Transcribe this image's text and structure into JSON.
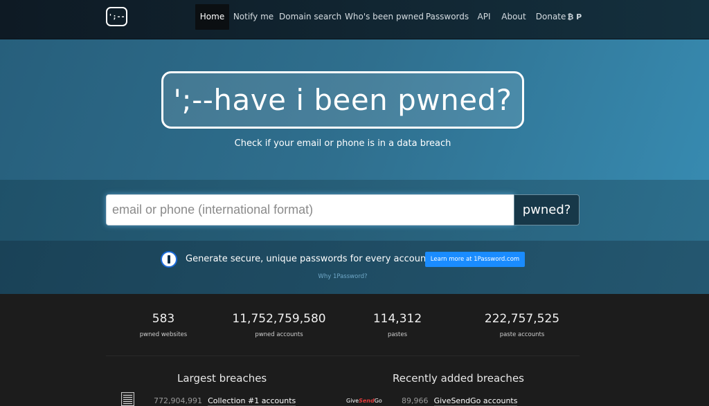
{
  "nav": {
    "logo_text": "';--",
    "items": [
      {
        "label": "Home",
        "active": true
      },
      {
        "label": "Notify me"
      },
      {
        "label": "Domain search"
      },
      {
        "label": "Who's been pwned"
      },
      {
        "label": "Passwords"
      },
      {
        "label": "API"
      },
      {
        "label": "About"
      },
      {
        "label": "Donate"
      }
    ],
    "donate_icons": "₿ P"
  },
  "hero": {
    "title": "';--have i been pwned?",
    "subtitle": "Check if your email or phone is in a data breach"
  },
  "search": {
    "placeholder": "email or phone (international format)",
    "button_label": "pwned?"
  },
  "promo": {
    "text": "Generate secure, unique passwords for every account",
    "button_label": "Learn more at 1Password.com",
    "why_link": "Why 1Password?"
  },
  "stats": [
    {
      "value": "583",
      "label": "pwned websites"
    },
    {
      "value": "11,752,759,580",
      "label": "pwned accounts"
    },
    {
      "value": "114,312",
      "label": "pastes"
    },
    {
      "value": "222,757,525",
      "label": "paste accounts"
    }
  ],
  "largest": {
    "title": "Largest breaches",
    "first": {
      "count": "772,904,991",
      "name": "Collection #1 accounts"
    }
  },
  "recent": {
    "title": "Recently added breaches",
    "logo_text_a": "Give",
    "logo_text_b": "Send",
    "logo_text_c": "Go",
    "first": {
      "count": "89,966",
      "name": "GiveSendGo accounts"
    }
  }
}
